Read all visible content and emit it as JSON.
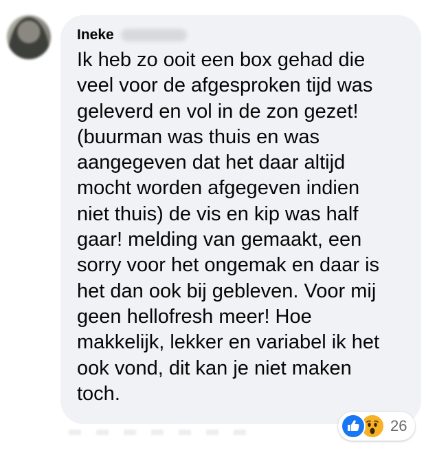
{
  "comment": {
    "author_name": "Ineke",
    "lines": [
      "Ik heb zo ooit een box gehad die",
      "veel voor de afgesproken tijd was",
      "geleverd en vol in de zon gezet!",
      "(buurman was thuis en was",
      "aangegeven dat het daar altijd",
      "mocht worden afgegeven indien",
      "niet thuis) de vis en kip was half",
      "gaar! melding van gemaakt, een",
      "sorry voor het ongemak en daar is",
      "het dan ook bij gebleven. Voor mij",
      "geen hellofresh meer! Hoe",
      "makkelijk, lekker en variabel ik het",
      "ook vond, dit kan je niet maken",
      "toch."
    ]
  },
  "reactions": {
    "types": [
      "like-icon",
      "wow-icon"
    ],
    "count": "26",
    "colors": {
      "like": "#1877f2",
      "wow": "#f7b125"
    }
  },
  "colors": {
    "bubble_bg": "#f0f2f5",
    "text": "#050505",
    "muted": "#65676b"
  }
}
